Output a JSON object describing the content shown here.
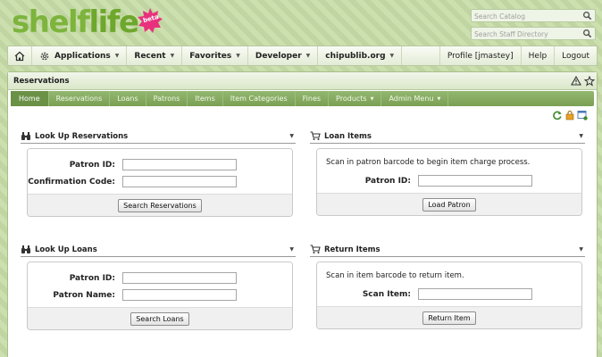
{
  "app": {
    "logo_shelf": "shelf",
    "logo_life": "life",
    "beta": "beta"
  },
  "search": {
    "catalog_placeholder": "Search Catalog",
    "staff_placeholder": "Search Staff Directory"
  },
  "topnav": {
    "items": [
      {
        "label": "Applications",
        "dropdown": true
      },
      {
        "label": "Recent",
        "dropdown": true
      },
      {
        "label": "Favorites",
        "dropdown": true
      },
      {
        "label": "Developer",
        "dropdown": true
      },
      {
        "label": "chipublib.org",
        "dropdown": true
      }
    ],
    "right": [
      "Profile [jmastey]",
      "Help",
      "Logout"
    ]
  },
  "panel": {
    "title": "Reservations"
  },
  "subnav": {
    "items": [
      "Home",
      "Reservations",
      "Loans",
      "Patrons",
      "Items",
      "Item Categories",
      "Fines",
      "Products",
      "Admin Menu"
    ]
  },
  "widgets": {
    "lookup_reservations": {
      "title": "Look Up Reservations",
      "label_patron_id": "Patron ID:",
      "label_confirmation": "Confirmation Code:",
      "button": "Search Reservations"
    },
    "loan_items": {
      "title": "Loan Items",
      "message": "Scan in patron barcode to begin item charge process.",
      "label_patron_id": "Patron ID:",
      "button": "Load Patron"
    },
    "lookup_loans": {
      "title": "Look Up Loans",
      "label_patron_id": "Patron ID:",
      "label_patron_name": "Patron Name:",
      "button": "Search Loans"
    },
    "return_items": {
      "title": "Return Items",
      "message": "Scan in item barcode to return item.",
      "label_scan_item": "Scan Item:",
      "button": "Return Item"
    }
  },
  "colors": {
    "background": "#c6dca6",
    "logo_green": "#7cb43c",
    "subnav_green": "#7aa053",
    "beta_pink": "#e8317d"
  }
}
